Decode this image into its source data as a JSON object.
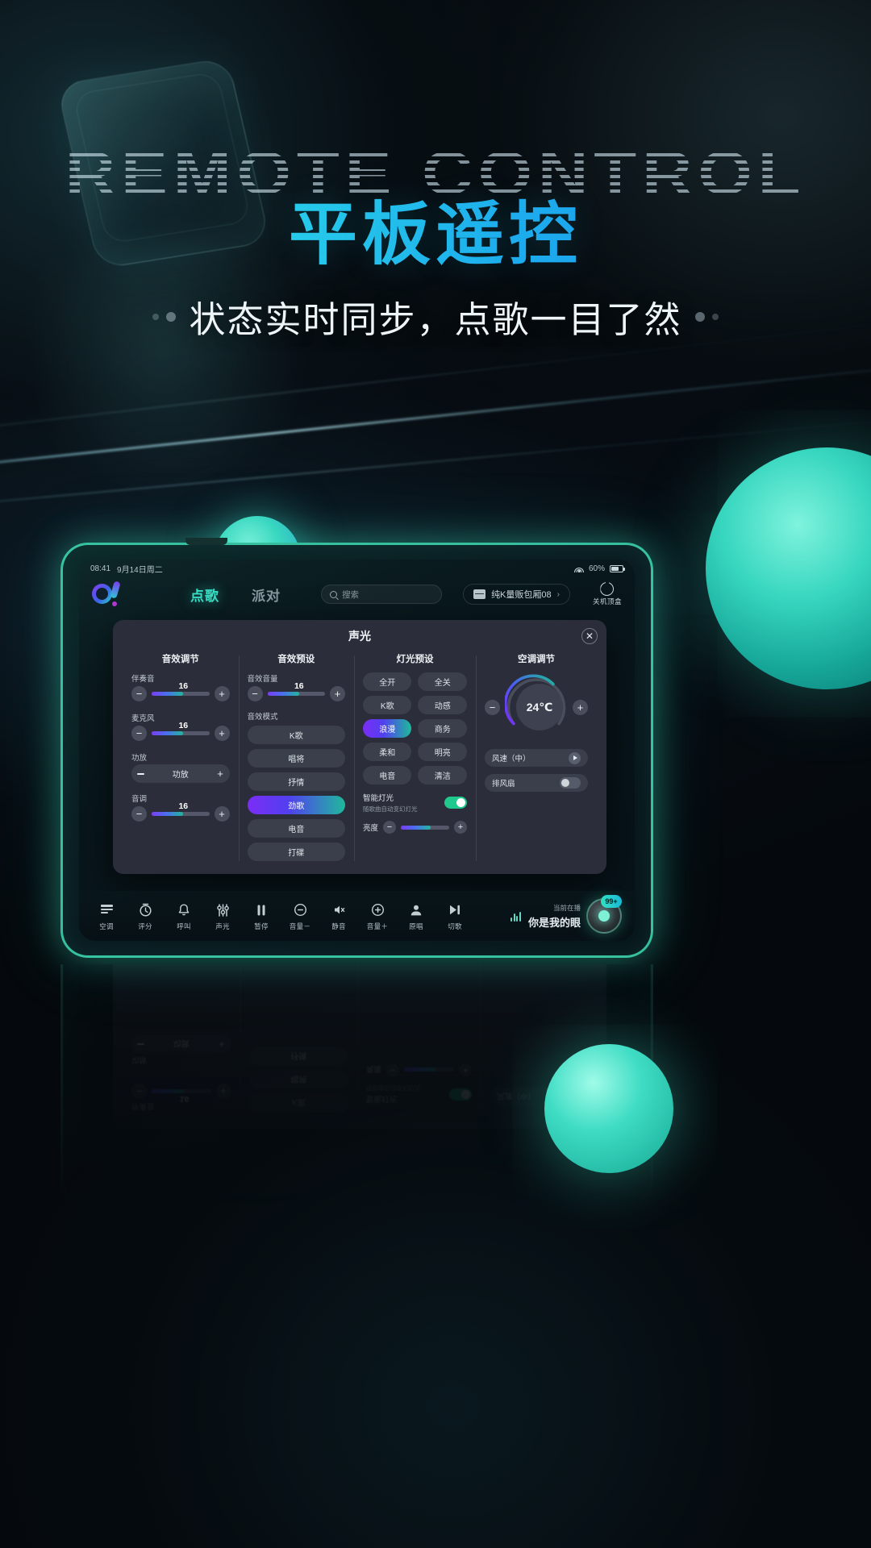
{
  "hero": {
    "ghost_text": "REMOTE CONTROL",
    "title": "平板遥控",
    "subtitle": "状态实时同步，点歌一目了然"
  },
  "tablet": {
    "statusbar": {
      "time": "08:41",
      "date": "9月14日周二",
      "battery": "60%"
    },
    "nav": {
      "tabs": [
        {
          "label": "点歌",
          "active": true
        },
        {
          "label": "派对",
          "active": false
        }
      ],
      "search_placeholder": "搜索",
      "room": "纯K量贩包厢08",
      "room_chevron": "›",
      "power_label": "关机顶盒"
    },
    "modal": {
      "title": "声光",
      "close_label": "✕",
      "columns": [
        {
          "title": "音效调节",
          "fields": [
            {
              "label": "伴奏音",
              "value": "16",
              "percent": 55
            },
            {
              "label": "麦克风",
              "value": "16",
              "percent": 55
            },
            {
              "label": "功放",
              "button_label": "功放",
              "minus": "−",
              "plus": "+"
            },
            {
              "label": "音调",
              "value": "16",
              "percent": 55
            }
          ]
        },
        {
          "title": "音效预设",
          "volume_label": "音效音量",
          "volume_value": "16",
          "volume_percent": 55,
          "mode_label": "音效模式",
          "modes": [
            {
              "label": "K歌",
              "active": false
            },
            {
              "label": "唱将",
              "active": false
            },
            {
              "label": "抒情",
              "active": false
            },
            {
              "label": "劲歌",
              "active": true
            },
            {
              "label": "电音",
              "active": false
            },
            {
              "label": "打碟",
              "active": false
            }
          ]
        },
        {
          "title": "灯光预设",
          "presets": [
            {
              "label": "全开",
              "active": false
            },
            {
              "label": "全关",
              "active": false
            },
            {
              "label": "K歌",
              "active": false
            },
            {
              "label": "动感",
              "active": false
            },
            {
              "label": "浪漫",
              "active": true
            },
            {
              "label": "商务",
              "active": false
            },
            {
              "label": "柔和",
              "active": false
            },
            {
              "label": "明亮",
              "active": false
            },
            {
              "label": "电音",
              "active": false
            },
            {
              "label": "清洁",
              "active": false
            }
          ],
          "smart_light": {
            "title": "智能灯光",
            "desc": "随歌曲自动变幻灯光",
            "on": true
          },
          "brightness": {
            "label": "亮度",
            "minus": "−",
            "plus": "+",
            "percent": 62
          }
        },
        {
          "title": "空调调节",
          "temperature": "24℃",
          "minus": "−",
          "plus": "+",
          "fan_speed": "风速（中）",
          "exhaust_fan": "排风扇"
        }
      ]
    },
    "bottombar": {
      "items": [
        {
          "label": "空调",
          "icon": "ac-icon"
        },
        {
          "label": "评分",
          "icon": "score-icon"
        },
        {
          "label": "呼叫",
          "icon": "bell-icon"
        },
        {
          "label": "声光",
          "icon": "sliders-icon"
        },
        {
          "label": "暂停",
          "icon": "pause-icon"
        },
        {
          "label": "音量－",
          "icon": "volume-down-icon"
        },
        {
          "label": "静音",
          "icon": "mute-icon"
        },
        {
          "label": "音量＋",
          "icon": "volume-up-icon"
        },
        {
          "label": "原唱",
          "icon": "original-vocal-icon"
        },
        {
          "label": "切歌",
          "icon": "next-song-icon"
        }
      ],
      "now_playing_label": "当前在播",
      "now_playing_song": "你是我的眼",
      "queue_badge": "99+"
    }
  }
}
